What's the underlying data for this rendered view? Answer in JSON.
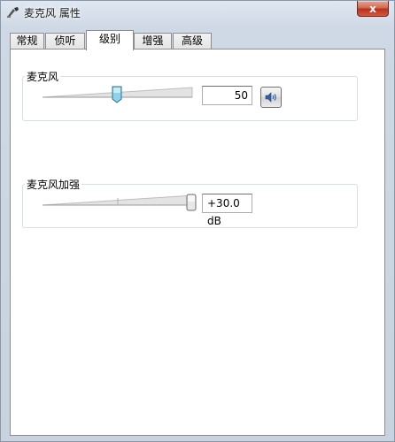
{
  "window": {
    "title": "麦克风 属性",
    "close_label": "x"
  },
  "tabs": [
    {
      "label": "常规",
      "active": false
    },
    {
      "label": "侦听",
      "active": false
    },
    {
      "label": "级别",
      "active": true
    },
    {
      "label": "增强",
      "active": false
    },
    {
      "label": "高级",
      "active": false
    }
  ],
  "microphone": {
    "label": "麦克风",
    "value": "50",
    "level_fraction": 0.5,
    "speaker_icon": "speaker-volume-icon"
  },
  "boost": {
    "label": "麦克风加强",
    "value": "+30.0 dB",
    "level_fraction": 1.0
  },
  "colors": {
    "thumb_blue": "#8fd3ea",
    "track_gray": "#dcdcdc",
    "close_red": "#c9402a"
  }
}
